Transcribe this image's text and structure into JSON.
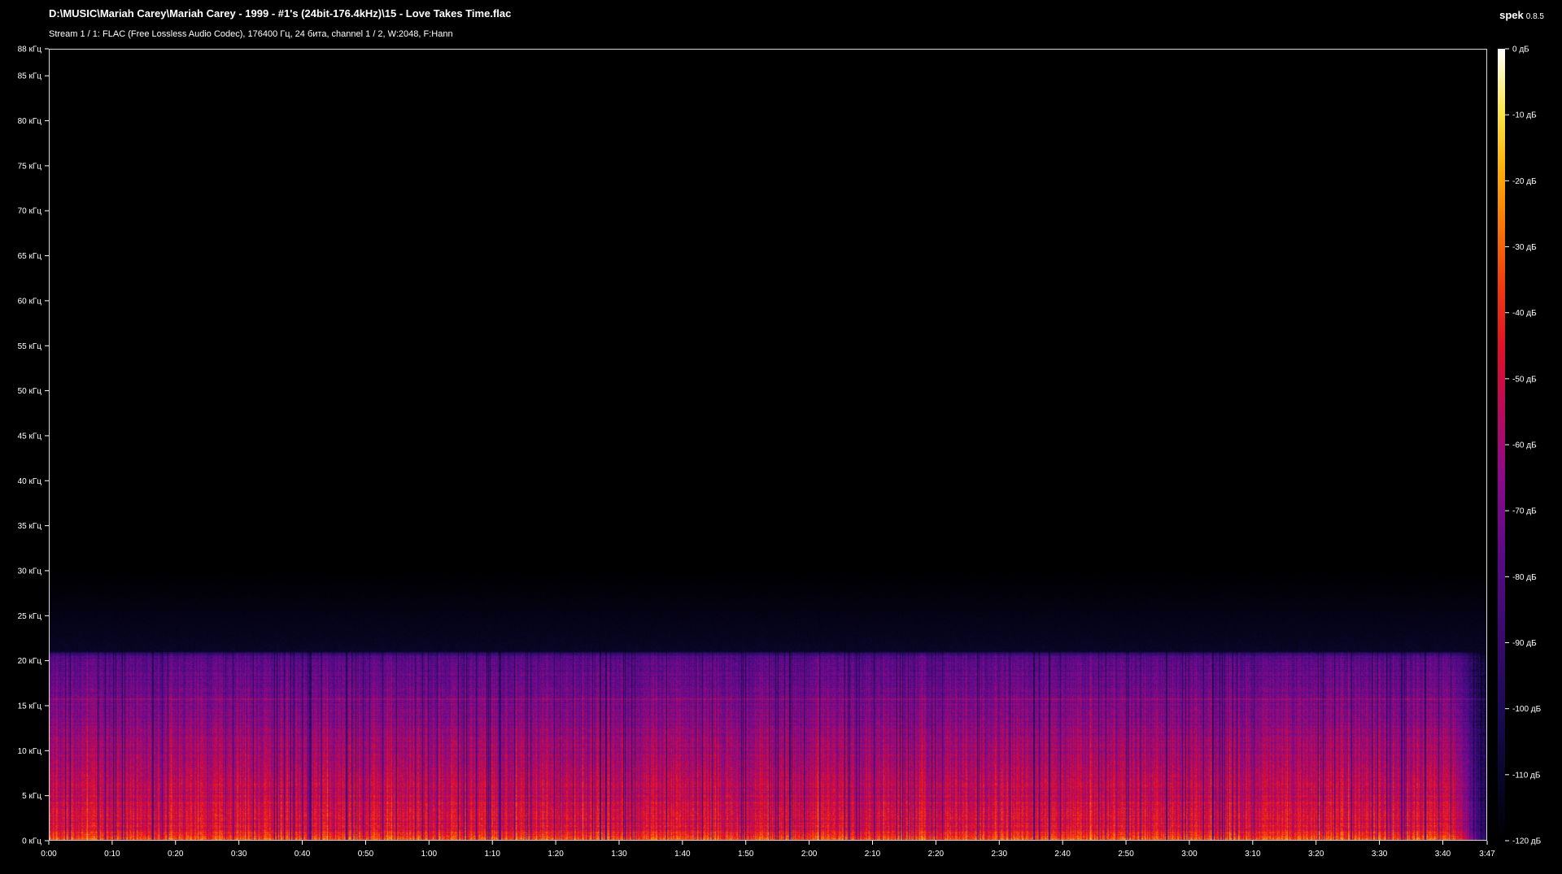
{
  "window": {
    "file_title": "D:\\MUSIC\\Mariah Carey\\Mariah Carey - 1999 -  #1's (24bit-176.4kHz)\\15 - Love Takes Time.flac",
    "stream_info": "Stream 1 / 1: FLAC (Free Lossless Audio Codec), 176400 Гц, 24 бита, channel 1 / 2, W:2048, F:Hann",
    "app_name": "spek",
    "app_version": "0.8.5"
  },
  "frequency_axis": {
    "unit": "кГц",
    "max_khz": 88,
    "ticks": [
      {
        "value": 0,
        "label": "0 кГц"
      },
      {
        "value": 5,
        "label": "5 кГц"
      },
      {
        "value": 10,
        "label": "10 кГц"
      },
      {
        "value": 15,
        "label": "15 кГц"
      },
      {
        "value": 20,
        "label": "20 кГц"
      },
      {
        "value": 25,
        "label": "25 кГц"
      },
      {
        "value": 30,
        "label": "30 кГц"
      },
      {
        "value": 35,
        "label": "35 кГц"
      },
      {
        "value": 40,
        "label": "40 кГц"
      },
      {
        "value": 45,
        "label": "45 кГц"
      },
      {
        "value": 50,
        "label": "50 кГц"
      },
      {
        "value": 55,
        "label": "55 кГц"
      },
      {
        "value": 60,
        "label": "60 кГц"
      },
      {
        "value": 65,
        "label": "65 кГц"
      },
      {
        "value": 70,
        "label": "70 кГц"
      },
      {
        "value": 75,
        "label": "75 кГц"
      },
      {
        "value": 80,
        "label": "80 кГц"
      },
      {
        "value": 85,
        "label": "85 кГц"
      },
      {
        "value": 88,
        "label": "88 кГц"
      }
    ]
  },
  "time_axis": {
    "duration_seconds": 227,
    "ticks": [
      {
        "value": 0,
        "label": "0:00"
      },
      {
        "value": 10,
        "label": "0:10"
      },
      {
        "value": 20,
        "label": "0:20"
      },
      {
        "value": 30,
        "label": "0:30"
      },
      {
        "value": 40,
        "label": "0:40"
      },
      {
        "value": 50,
        "label": "0:50"
      },
      {
        "value": 60,
        "label": "1:00"
      },
      {
        "value": 70,
        "label": "1:10"
      },
      {
        "value": 80,
        "label": "1:20"
      },
      {
        "value": 90,
        "label": "1:30"
      },
      {
        "value": 100,
        "label": "1:40"
      },
      {
        "value": 110,
        "label": "1:50"
      },
      {
        "value": 120,
        "label": "2:00"
      },
      {
        "value": 130,
        "label": "2:10"
      },
      {
        "value": 140,
        "label": "2:20"
      },
      {
        "value": 150,
        "label": "2:30"
      },
      {
        "value": 160,
        "label": "2:40"
      },
      {
        "value": 170,
        "label": "2:50"
      },
      {
        "value": 180,
        "label": "3:00"
      },
      {
        "value": 190,
        "label": "3:10"
      },
      {
        "value": 200,
        "label": "3:20"
      },
      {
        "value": 210,
        "label": "3:30"
      },
      {
        "value": 220,
        "label": "3:40"
      },
      {
        "value": 227,
        "label": "3:47"
      }
    ]
  },
  "db_scale": {
    "min_db": -120,
    "max_db": 0,
    "ticks": [
      {
        "value": 0,
        "label": "0 дБ"
      },
      {
        "value": -10,
        "label": "-10 дБ"
      },
      {
        "value": -20,
        "label": "-20 дБ"
      },
      {
        "value": -30,
        "label": "-30 дБ"
      },
      {
        "value": -40,
        "label": "-40 дБ"
      },
      {
        "value": -50,
        "label": "-50 дБ"
      },
      {
        "value": -60,
        "label": "-60 дБ"
      },
      {
        "value": -70,
        "label": "-70 дБ"
      },
      {
        "value": -80,
        "label": "-80 дБ"
      },
      {
        "value": -90,
        "label": "-90 дБ"
      },
      {
        "value": -100,
        "label": "-100 дБ"
      },
      {
        "value": -110,
        "label": "-110 дБ"
      },
      {
        "value": -120,
        "label": "-120 дБ"
      }
    ]
  },
  "spectrogram": {
    "content_cutoff_khz": 21,
    "faint_noise_up_to_khz": 30,
    "band_line_khz": 15.7
  },
  "colors": {
    "background": "#000000",
    "frame": "#d8d8d8",
    "text": "#ffffff"
  }
}
